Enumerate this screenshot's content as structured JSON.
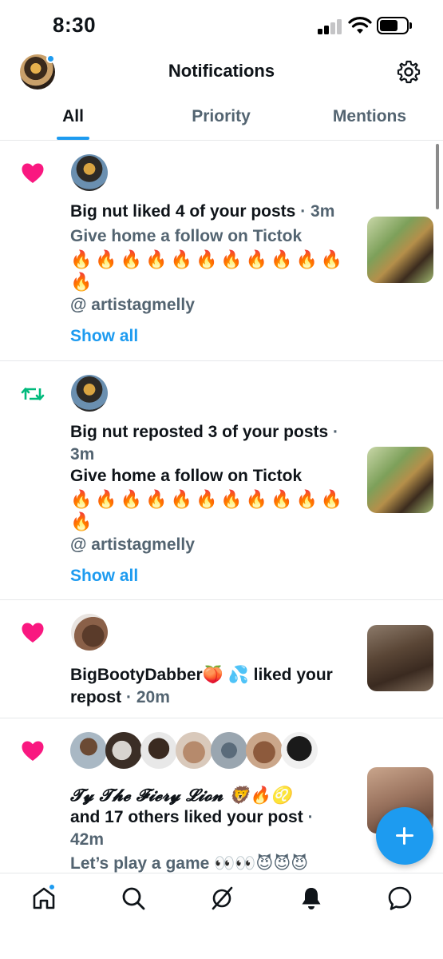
{
  "status_bar": {
    "time": "8:30"
  },
  "header": {
    "title": "Notifications"
  },
  "tabs": [
    {
      "label": "All",
      "active": true
    },
    {
      "label": "Priority",
      "active": false
    },
    {
      "label": "Mentions",
      "active": false
    }
  ],
  "notifications": [
    {
      "type_icon": "heart-icon",
      "headline_name": "Big nut",
      "headline_action": " liked 4 of your posts",
      "time": "3m",
      "post_title": "Give home a follow on Tictok",
      "emoji_row1": "🔥🔥🔥🔥🔥🔥🔥🔥🔥🔥🔥",
      "emoji_row2": "🔥",
      "handle_line": "@ artistagmelly",
      "show_all": "Show all"
    },
    {
      "type_icon": "repost-icon",
      "headline_name": "Big nut",
      "headline_action": " reposted 3 of your posts",
      "time": "3m",
      "post_title": "Give home a follow on Tictok",
      "emoji_row1": "🔥🔥🔥🔥🔥🔥🔥🔥🔥🔥🔥",
      "emoji_row2": "🔥",
      "handle_line": "@ artistagmelly",
      "show_all": "Show all"
    },
    {
      "type_icon": "heart-icon",
      "headline_name": "BigBootyDabber🍑 💦",
      "headline_action": " liked your repost",
      "time": "20m"
    },
    {
      "type_icon": "heart-icon",
      "headline_name": "𝓣𝔂 𝓣𝓱𝓮 𝓕𝓲𝓮𝓻𝔂 𝓛𝓲𝓸𝓷 🦁🔥♌",
      "headline_action": "and 17 others liked your post",
      "time": "42m",
      "post_title": "Let’s play a game 👀👀😈😈😈"
    }
  ],
  "colors": {
    "accent": "#1d9bf0",
    "like": "#f91880",
    "repost": "#00ba7c",
    "muted": "#536471"
  }
}
